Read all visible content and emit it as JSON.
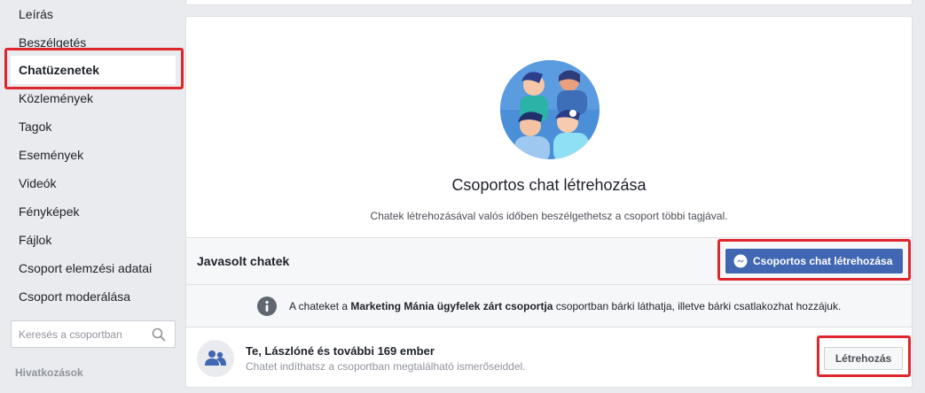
{
  "sidebar": {
    "items": [
      {
        "label": "Leírás"
      },
      {
        "label": "Beszélgetés"
      },
      {
        "label": "Chatüzenetek"
      },
      {
        "label": "Közlemények"
      },
      {
        "label": "Tagok"
      },
      {
        "label": "Események"
      },
      {
        "label": "Videók"
      },
      {
        "label": "Fényképek"
      },
      {
        "label": "Fájlok"
      },
      {
        "label": "Csoport elemzési adatai"
      },
      {
        "label": "Csoport moderálása"
      }
    ],
    "search_placeholder": "Keresés a csoportban",
    "section_header": "Hivatkozások"
  },
  "hero": {
    "title": "Csoportos chat létrehozása",
    "subtitle": "Chatek létrehozásával valós időben beszélgethetsz a csoport többi tagjával."
  },
  "suggested": {
    "title": "Javasolt chatek",
    "create_button": "Csoportos chat létrehozása"
  },
  "info": {
    "prefix": "A chateket a ",
    "group_name": "Marketing Mánia ügyfelek zárt csoportja",
    "suffix": " csoportban bárki láthatja, illetve bárki csatlakozhat hozzájuk."
  },
  "chat_suggestion": {
    "title": "Te, Lászlóné és további 169 ember",
    "subtitle": "Chatet indíthatsz a csoportban megtalálható ismerőseiddel.",
    "button": "Létrehozás"
  },
  "colors": {
    "accent": "#4267b2",
    "highlight": "#e0262d",
    "background": "#e9ebee"
  }
}
